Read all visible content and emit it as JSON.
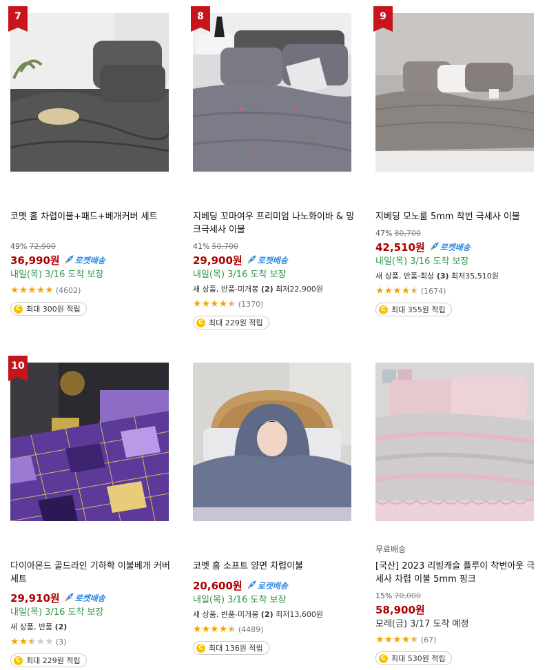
{
  "products": [
    {
      "rank": "7",
      "delivery_tag": "",
      "title": "코멧 홈 차렵이불+패드+베개커버 세트",
      "discount_pct": "49%",
      "orig_price": "72,900",
      "price": "36,990원",
      "rocket_label": "로켓배송",
      "arrival": "내일(목) 3/16 도착 보장",
      "used_prefix": "",
      "used_count": "",
      "used_min": "",
      "rating": 5,
      "review_count": "(4602)",
      "points": "최대 300원 적립"
    },
    {
      "rank": "8",
      "delivery_tag": "",
      "title": "지베딩 꼬마여우 프리미엄 나노화이바 & 밍크극세사 이불",
      "discount_pct": "41%",
      "orig_price": "50,700",
      "price": "29,900원",
      "rocket_label": "로켓배송",
      "arrival": "내일(목) 3/16 도착 보장",
      "used_prefix": "새 상품, 반품-미개봉",
      "used_count": "(2)",
      "used_min": "최저22,900원",
      "rating": 4.5,
      "review_count": "(1370)",
      "points": "최대 229원 적립"
    },
    {
      "rank": "9",
      "delivery_tag": "",
      "title": "지베딩 모노룸 5mm 착번 극세사 이불",
      "discount_pct": "47%",
      "orig_price": "80,700",
      "price": "42,510원",
      "rocket_label": "로켓배송",
      "arrival": "내일(목) 3/16 도착 보장",
      "used_prefix": "새 상품, 반품-최상",
      "used_count": "(3)",
      "used_min": "최저35,510원",
      "rating": 4.5,
      "review_count": "(1674)",
      "points": "최대 355원 적립"
    },
    {
      "rank": "10",
      "delivery_tag": "",
      "title": "다이아몬드 골드라인 기하학 이불베개 커버 세트",
      "discount_pct": "",
      "orig_price": "",
      "price": "29,910원",
      "rocket_label": "로켓배송",
      "arrival": "내일(목) 3/16 도착 보장",
      "used_prefix": "새 상품, 반품",
      "used_count": "(2)",
      "used_min": "",
      "rating": 2.5,
      "review_count": "(3)",
      "points": "최대 229원 적립"
    },
    {
      "rank": "",
      "delivery_tag": "",
      "title": "코멧 홈 소프트 양면 차렵이불",
      "discount_pct": "",
      "orig_price": "",
      "price": "20,600원",
      "rocket_label": "로켓배송",
      "arrival": "내일(목) 3/16 도착 보장",
      "used_prefix": "새 상품, 반품-미개봉",
      "used_count": "(2)",
      "used_min": "최저13,600원",
      "rating": 4.5,
      "review_count": "(4489)",
      "points": "최대 136원 적립"
    },
    {
      "rank": "",
      "delivery_tag": "무료배송",
      "title": "[국산] 2023 리빙캐슬 플루이 착번아웃 극세사 차렵 이불 5mm 핑크",
      "discount_pct": "15%",
      "orig_price": "70,000",
      "price": "58,900원",
      "rocket_label": "",
      "arrival": "모레(금) 3/17 도착 예정",
      "used_prefix": "",
      "used_count": "",
      "used_min": "",
      "rating": 4.5,
      "review_count": "(67)",
      "points": "최대 530원 적립"
    }
  ],
  "colors": {
    "rank_badge": "#c8151d",
    "price": "#ae0000",
    "rocket": "#2f8ae0",
    "arrival": "#30954b",
    "star": "#f6a300"
  }
}
